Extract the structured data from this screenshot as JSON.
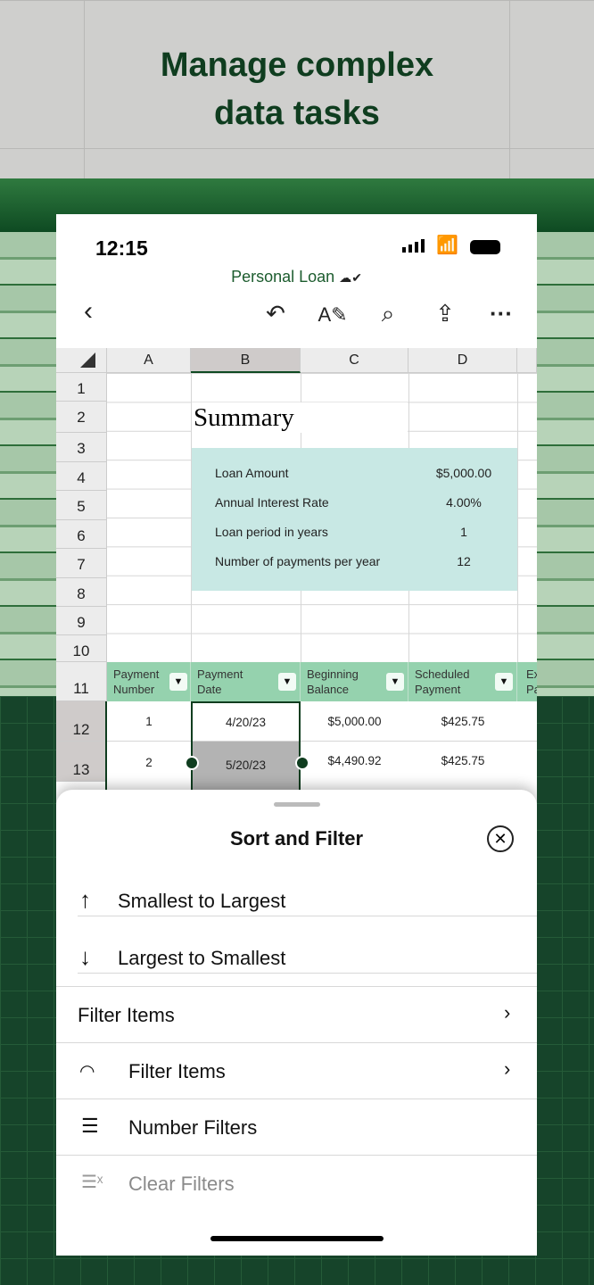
{
  "headline": [
    "Manage complex",
    "data tasks"
  ],
  "status": {
    "time": "12:15"
  },
  "doc_title": "Personal Loan",
  "columns": [
    "A",
    "B",
    "C",
    "D"
  ],
  "rows": [
    "1",
    "2",
    "3",
    "4",
    "5",
    "6",
    "7",
    "8",
    "9",
    "10",
    "11",
    "12",
    "13"
  ],
  "summary": {
    "title": "Summary",
    "items": [
      {
        "label": "Loan Amount",
        "value": "$5,000.00"
      },
      {
        "label": "Annual Interest Rate",
        "value": "4.00%"
      },
      {
        "label": "Loan period in years",
        "value": "1"
      },
      {
        "label": "Number of payments per year",
        "value": "12"
      }
    ]
  },
  "table": {
    "headers": [
      [
        "Payment",
        "Number"
      ],
      [
        "Payment",
        "Date"
      ],
      [
        "Beginning",
        "Balance"
      ],
      [
        "Scheduled",
        "Payment"
      ],
      [
        "Ex",
        "Pa"
      ]
    ],
    "rows": [
      [
        "1",
        "4/20/23",
        "$5,000.00",
        "$425.75"
      ],
      [
        "2",
        "5/20/23",
        "$4,490.92",
        "$425.75"
      ]
    ]
  },
  "sheet": {
    "title": "Sort and Filter",
    "sort_asc": "Smallest to Largest",
    "sort_desc": "Largest to Smallest",
    "filter_items_1": "Filter Items",
    "filter_items_2": "Filter Items",
    "number_filters": "Number Filters",
    "clear_filters": "Clear Filters"
  }
}
